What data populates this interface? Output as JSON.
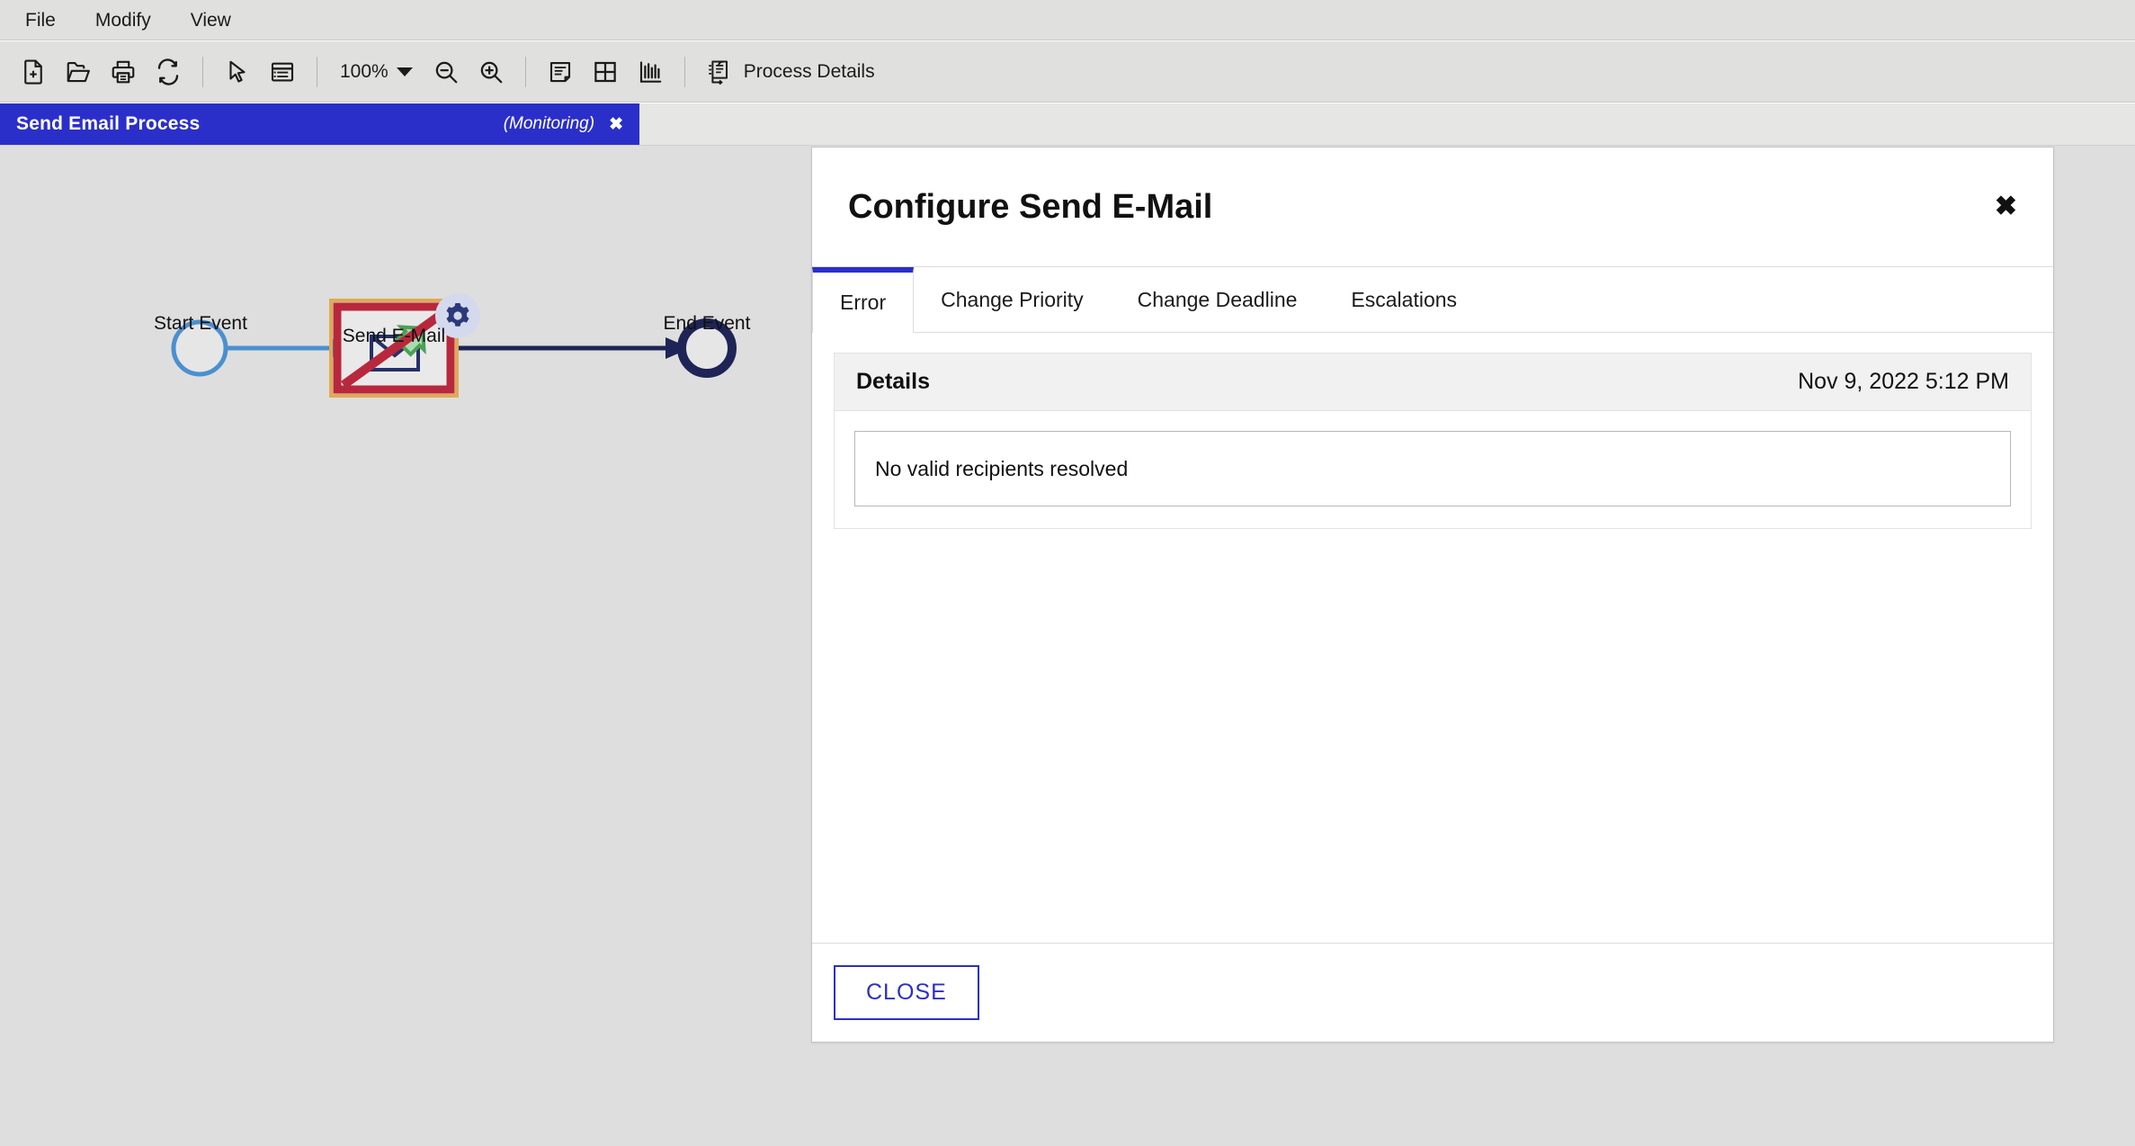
{
  "menubar": {
    "items": [
      {
        "label": "File"
      },
      {
        "label": "Modify"
      },
      {
        "label": "View"
      }
    ]
  },
  "toolbar": {
    "buttons": [
      {
        "name": "new-document-icon",
        "title": "New"
      },
      {
        "name": "open-folder-icon",
        "title": "Open"
      },
      {
        "name": "print-icon",
        "title": "Print"
      },
      {
        "name": "refresh-icon",
        "title": "Refresh"
      },
      {
        "name": "pointer-icon",
        "title": "Select"
      },
      {
        "name": "properties-list-icon",
        "title": "Properties"
      },
      {
        "name": "zoom-out-icon",
        "title": "Zoom Out"
      },
      {
        "name": "zoom-in-icon",
        "title": "Zoom In"
      },
      {
        "name": "report-document-icon",
        "title": "Report"
      },
      {
        "name": "grid-table-icon",
        "title": "Grid"
      },
      {
        "name": "bar-chart-icon",
        "title": "Statistics"
      }
    ],
    "zoom_level": "100%",
    "process_details_label": "Process Details"
  },
  "process_tab": {
    "title": "Send Email Process",
    "state": "(Monitoring)",
    "close_glyph": "✖"
  },
  "diagram": {
    "nodes": [
      {
        "id": "start",
        "label": "Start Event",
        "type": "start-event"
      },
      {
        "id": "task",
        "label": "Send E-Mail",
        "type": "send-task"
      },
      {
        "id": "end",
        "label": "End Event",
        "type": "end-event"
      }
    ],
    "colors": {
      "start_stroke": "#4a90d0",
      "flow_incoming": "#4a90d0",
      "flow_outgoing": "#1f2456",
      "end_stroke": "#1f2456",
      "task_outer_border": "#e0a955",
      "task_error_border": "#b8283c",
      "task_fill": "#e9e9e9",
      "envelope": "#25306b",
      "arrow_green": "#4ba055",
      "badge_bg": "#d5d9ee",
      "badge_gear": "#2c3a7a",
      "canvas_bg": "#dedede"
    }
  },
  "dialog": {
    "title": "Configure Send E-Mail",
    "close_glyph": "✖",
    "tabs": [
      {
        "label": "Error",
        "active": true
      },
      {
        "label": "Change Priority",
        "active": false
      },
      {
        "label": "Change Deadline",
        "active": false
      },
      {
        "label": "Escalations",
        "active": false
      }
    ],
    "error_panel": {
      "heading": "Details",
      "timestamp": "Nov 9, 2022 5:12 PM",
      "message": "No valid recipients resolved"
    },
    "footer": {
      "close_button": "CLOSE"
    },
    "accent_color": "#2b2fc9"
  }
}
